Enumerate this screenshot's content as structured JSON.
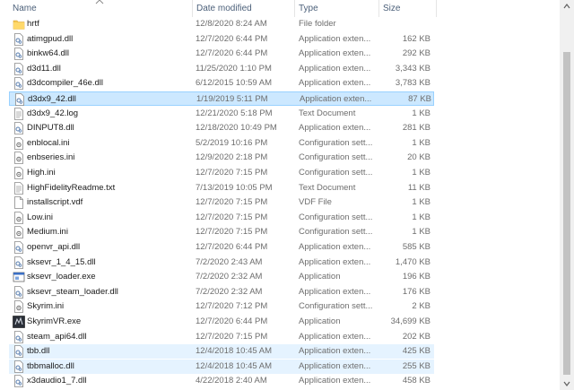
{
  "columns": {
    "name": "Name",
    "date": "Date modified",
    "type": "Type",
    "size": "Size"
  },
  "files": [
    {
      "name": "hrtf",
      "date": "12/8/2020 8:24 AM",
      "type": "File folder",
      "size": "",
      "icon": "folder-icon"
    },
    {
      "name": "atimgpud.dll",
      "date": "12/7/2020 6:44 PM",
      "type": "Application exten...",
      "size": "162 KB",
      "icon": "dll-file-icon"
    },
    {
      "name": "binkw64.dll",
      "date": "12/7/2020 6:44 PM",
      "type": "Application exten...",
      "size": "292 KB",
      "icon": "dll-file-icon"
    },
    {
      "name": "d3d11.dll",
      "date": "11/25/2020 1:10 PM",
      "type": "Application exten...",
      "size": "3,343 KB",
      "icon": "dll-file-icon"
    },
    {
      "name": "d3dcompiler_46e.dll",
      "date": "6/12/2015 10:59 AM",
      "type": "Application exten...",
      "size": "3,783 KB",
      "icon": "dll-file-icon"
    },
    {
      "name": "d3dx9_42.dll",
      "date": "1/19/2019 5:11 PM",
      "type": "Application exten...",
      "size": "87 KB",
      "icon": "dll-file-icon",
      "state": "selected"
    },
    {
      "name": "d3dx9_42.log",
      "date": "12/21/2020 5:18 PM",
      "type": "Text Document",
      "size": "1 KB",
      "icon": "text-file-icon"
    },
    {
      "name": "DINPUT8.dll",
      "date": "12/18/2020 10:49 PM",
      "type": "Application exten...",
      "size": "281 KB",
      "icon": "dll-file-icon"
    },
    {
      "name": "enblocal.ini",
      "date": "5/2/2019 10:16 PM",
      "type": "Configuration sett...",
      "size": "1 KB",
      "icon": "config-file-icon"
    },
    {
      "name": "enbseries.ini",
      "date": "12/9/2020 2:18 PM",
      "type": "Configuration sett...",
      "size": "20 KB",
      "icon": "config-file-icon"
    },
    {
      "name": "High.ini",
      "date": "12/7/2020 7:15 PM",
      "type": "Configuration sett...",
      "size": "1 KB",
      "icon": "config-file-icon"
    },
    {
      "name": "HighFidelityReadme.txt",
      "date": "7/13/2019 10:05 PM",
      "type": "Text Document",
      "size": "11 KB",
      "icon": "text-file-icon"
    },
    {
      "name": "installscript.vdf",
      "date": "12/7/2020 7:15 PM",
      "type": "VDF File",
      "size": "1 KB",
      "icon": "blank-file-icon"
    },
    {
      "name": "Low.ini",
      "date": "12/7/2020 7:15 PM",
      "type": "Configuration sett...",
      "size": "1 KB",
      "icon": "config-file-icon"
    },
    {
      "name": "Medium.ini",
      "date": "12/7/2020 7:15 PM",
      "type": "Configuration sett...",
      "size": "1 KB",
      "icon": "config-file-icon"
    },
    {
      "name": "openvr_api.dll",
      "date": "12/7/2020 6:44 PM",
      "type": "Application exten...",
      "size": "585 KB",
      "icon": "dll-file-icon"
    },
    {
      "name": "sksevr_1_4_15.dll",
      "date": "7/2/2020 2:43 AM",
      "type": "Application exten...",
      "size": "1,470 KB",
      "icon": "dll-file-icon"
    },
    {
      "name": "sksevr_loader.exe",
      "date": "7/2/2020 2:32 AM",
      "type": "Application",
      "size": "196 KB",
      "icon": "exe-file-icon"
    },
    {
      "name": "sksevr_steam_loader.dll",
      "date": "7/2/2020 2:32 AM",
      "type": "Application exten...",
      "size": "176 KB",
      "icon": "dll-file-icon"
    },
    {
      "name": "Skyrim.ini",
      "date": "12/7/2020 7:12 PM",
      "type": "Configuration sett...",
      "size": "2 KB",
      "icon": "config-file-icon"
    },
    {
      "name": "SkyrimVR.exe",
      "date": "12/7/2020 6:44 PM",
      "type": "Application",
      "size": "34,699 KB",
      "icon": "skyrim-app-icon"
    },
    {
      "name": "steam_api64.dll",
      "date": "12/7/2020 7:15 PM",
      "type": "Application exten...",
      "size": "202 KB",
      "icon": "dll-file-icon"
    },
    {
      "name": "tbb.dll",
      "date": "12/4/2018 10:45 AM",
      "type": "Application exten...",
      "size": "425 KB",
      "icon": "dll-file-icon",
      "state": "hover"
    },
    {
      "name": "tbbmalloc.dll",
      "date": "12/4/2018 10:45 AM",
      "type": "Application exten...",
      "size": "255 KB",
      "icon": "dll-file-icon",
      "state": "hover"
    },
    {
      "name": "x3daudio1_7.dll",
      "date": "4/22/2018 2:40 AM",
      "type": "Application exten...",
      "size": "458 KB",
      "icon": "dll-file-icon"
    }
  ],
  "colors": {
    "selected": "#cce8ff",
    "hover": "#e5f3ff",
    "header_text": "#4c607a",
    "folder": "#e8b84a"
  }
}
